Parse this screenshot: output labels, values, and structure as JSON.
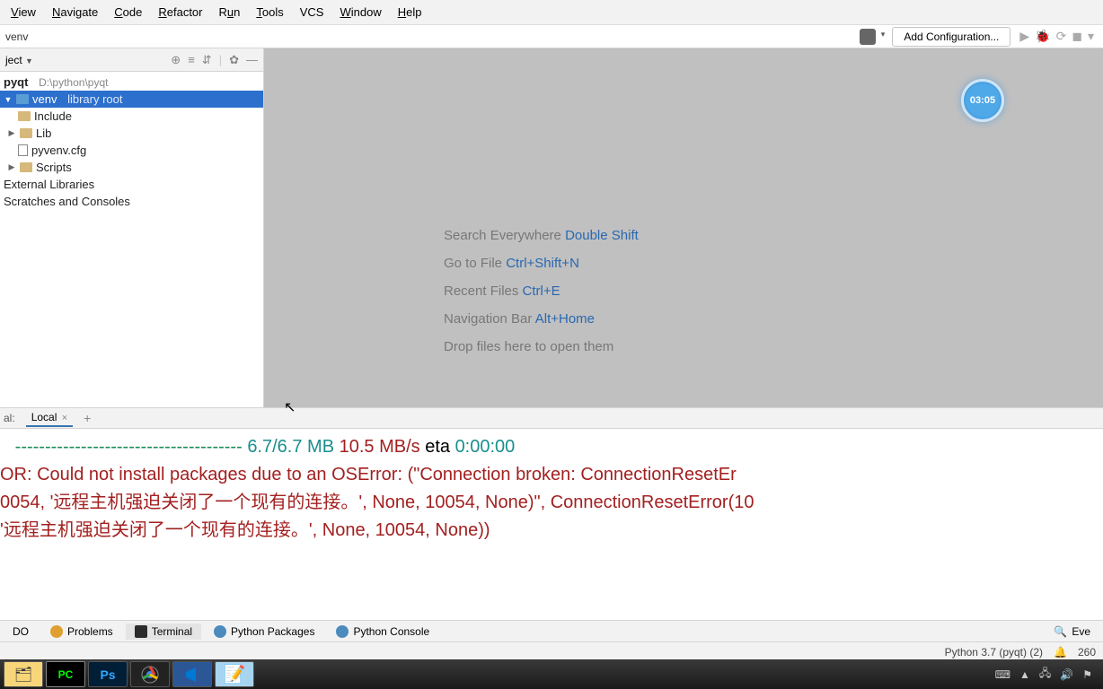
{
  "menu": {
    "view": "View",
    "navigate": "Navigate",
    "code": "Code",
    "refactor": "Refactor",
    "run": "Run",
    "tools": "Tools",
    "vcs": "VCS",
    "window": "Window",
    "help": "Help"
  },
  "navbar": {
    "path": "venv",
    "add_config": "Add Configuration..."
  },
  "project_header": {
    "title": "ject"
  },
  "tree": {
    "root_name": "pyqt",
    "root_path": "D:\\python\\pyqt",
    "venv": "venv",
    "venv_suffix": "library root",
    "include": "Include",
    "lib": "Lib",
    "pyvenv": "pyvenv.cfg",
    "scripts": "Scripts",
    "ext_libs": "External Libraries",
    "scratches": "Scratches and Consoles"
  },
  "help": {
    "search": "Search Everywhere ",
    "search_sc": "Double Shift",
    "goto": "Go to File ",
    "goto_sc": "Ctrl+Shift+N",
    "recent": "Recent Files ",
    "recent_sc": "Ctrl+E",
    "nav": "Navigation Bar ",
    "nav_sc": "Alt+Home",
    "drop": "Drop files here to open them"
  },
  "timer": "03:05",
  "terminal_tabs": {
    "label": "al:",
    "local": "Local"
  },
  "terminal": {
    "progress_bar": "   -------------------------------------- ",
    "progress_size": "6.7/6.7 MB",
    "progress_speed": " 10.5 MB/s",
    "progress_eta_lbl": " eta ",
    "progress_eta": "0:00:00",
    "err1": "OR: Could not install packages due to an OSError: (\"Connection broken: ConnectionResetEr",
    "err2": "0054, '远程主机强迫关闭了一个现有的连接。', None, 10054, None)\", ConnectionResetError(10",
    "err3": "'远程主机强迫关闭了一个现有的连接。', None, 10054, None))"
  },
  "bottom_tabs": {
    "todo": "DO",
    "problems": "Problems",
    "terminal": "Terminal",
    "python_packages": "Python Packages",
    "python_console": "Python Console",
    "eve": "Eve"
  },
  "status": {
    "interpreter": "Python 3.7 (pyqt) (2)",
    "col": "260"
  }
}
